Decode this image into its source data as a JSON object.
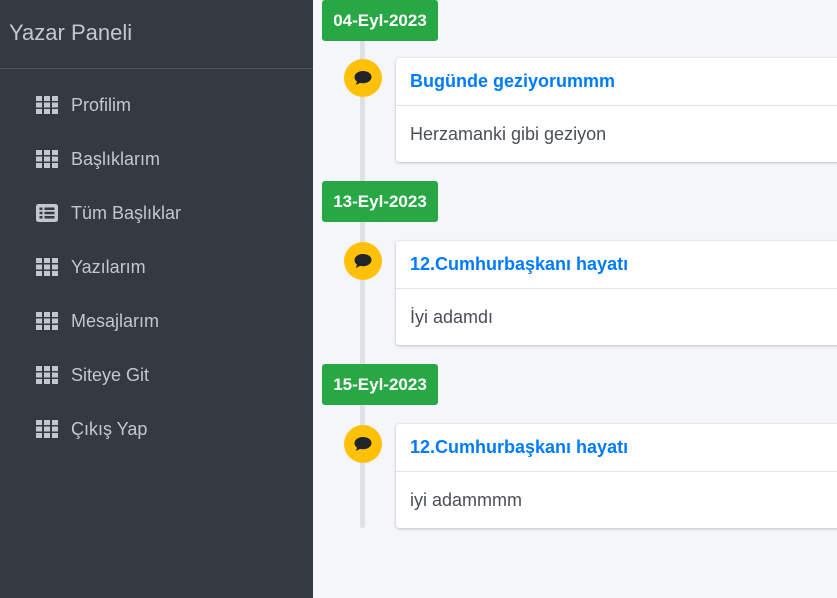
{
  "sidebar": {
    "brand": "Yazar Paneli",
    "items": [
      {
        "label": "Profilim",
        "icon": "grid-icon"
      },
      {
        "label": "Başlıklarım",
        "icon": "grid-icon"
      },
      {
        "label": "Tüm Başlıklar",
        "icon": "list-icon"
      },
      {
        "label": "Yazılarım",
        "icon": "grid-icon"
      },
      {
        "label": "Mesajlarım",
        "icon": "grid-icon"
      },
      {
        "label": "Siteye Git",
        "icon": "grid-icon"
      },
      {
        "label": "Çıkış Yap",
        "icon": "grid-icon"
      }
    ]
  },
  "timeline": [
    {
      "date": "04-Eyl-2023",
      "title": "Bugünde geziyorummm",
      "body": "Herzamanki gibi geziyon"
    },
    {
      "date": "13-Eyl-2023",
      "title": "12.Cumhurbaşkanı hayatı",
      "body": "İyi adamdı"
    },
    {
      "date": "15-Eyl-2023",
      "title": "12.Cumhurbaşkanı hayatı",
      "body": "iyi adammmm"
    }
  ],
  "colors": {
    "sidebar_bg": "#343a40",
    "date_label": "#28a745",
    "icon_bubble": "#ffc107",
    "title_link": "#007bff"
  }
}
